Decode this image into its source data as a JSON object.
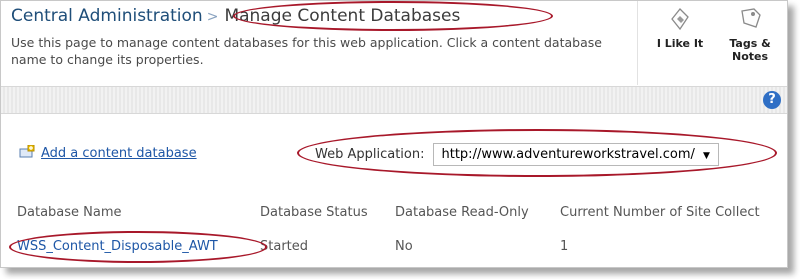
{
  "breadcrumb": {
    "root": "Central Administration",
    "separator": ">",
    "current": "Manage Content Databases"
  },
  "description": "Use this page to manage content databases for this web application. Click a content database name to change its properties.",
  "tools": {
    "like": {
      "label": "I Like It",
      "icon": "thumbs-up-tag-icon"
    },
    "tags": {
      "label": "Tags & Notes",
      "icon": "tag-notes-icon"
    }
  },
  "help_label": "?",
  "actions": {
    "add_database": "Add a content database"
  },
  "web_application": {
    "label": "Web Application:",
    "value": "http://www.adventureworkstravel.com/"
  },
  "table": {
    "headers": [
      "Database Name",
      "Database Status",
      "Database Read-Only",
      "Current Number of Site Collect"
    ],
    "rows": [
      [
        "WSS_Content_Disposable_AWT",
        "Started",
        "No",
        "1"
      ]
    ]
  }
}
